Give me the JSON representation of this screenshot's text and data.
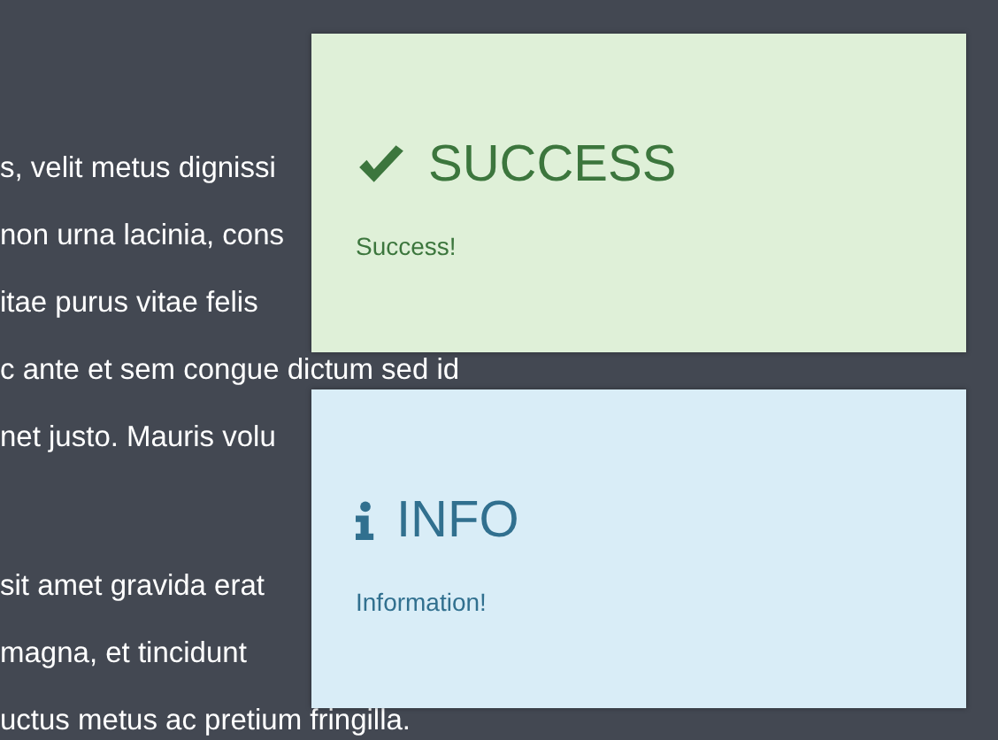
{
  "background_text": {
    "paragraphs": [
      [
        "s, velit metus dignissi",
        "non urna lacinia, cons",
        "itae purus vitae felis",
        "c ante et sem congue dictum sed id",
        "net justo. Mauris volu"
      ],
      [
        "sit amet gravida erat",
        "magna, et tincidunt",
        "uctus metus ac pretium fringilla."
      ]
    ]
  },
  "notifications": [
    {
      "kind": "success",
      "title": "SUCCESS",
      "message": "Success!"
    },
    {
      "kind": "info",
      "title": "INFO",
      "message": "Information!"
    }
  ]
}
